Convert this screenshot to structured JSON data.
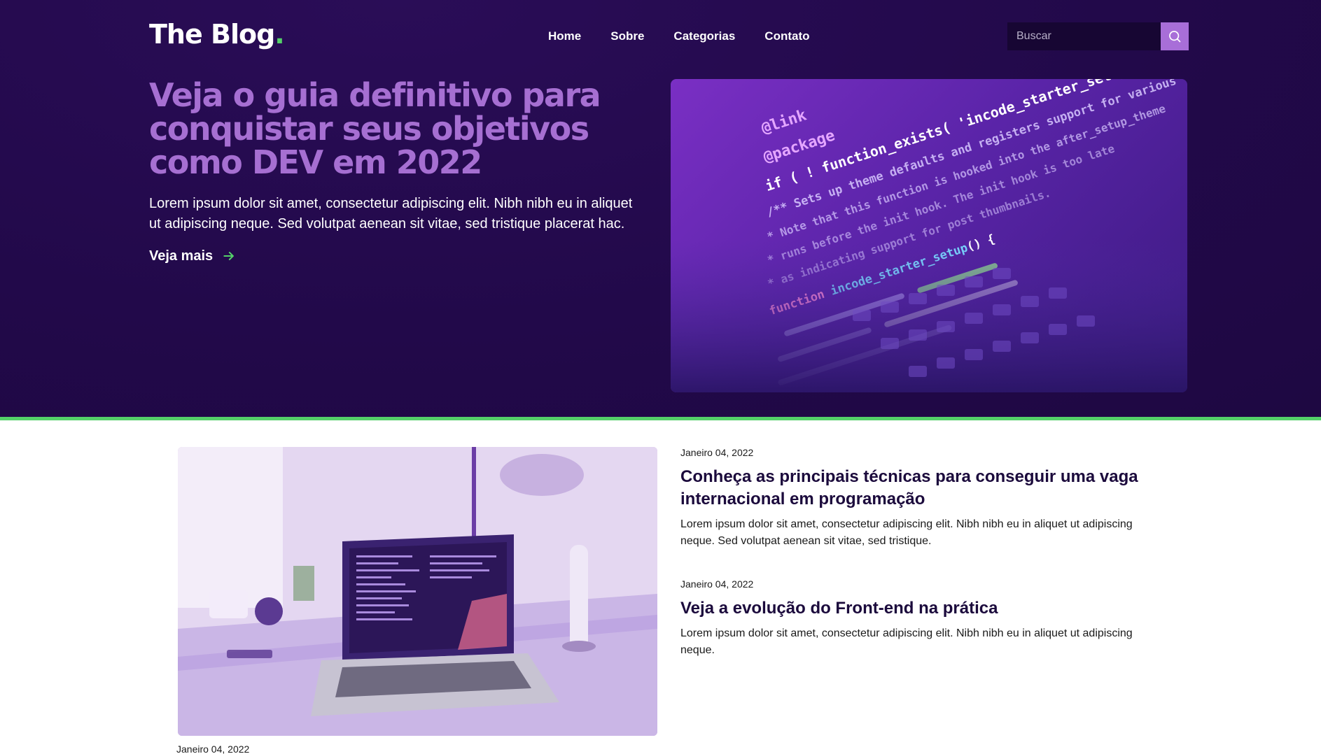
{
  "header": {
    "logo_text": "The Blog",
    "logo_dot": ".",
    "nav": [
      {
        "label": "Home"
      },
      {
        "label": "Sobre"
      },
      {
        "label": "Categorias"
      },
      {
        "label": "Contato"
      }
    ],
    "search": {
      "placeholder": "Buscar",
      "icon": "search-icon"
    }
  },
  "hero": {
    "title": "Veja o guia definitivo para conquistar seus objetivos como DEV em 2022",
    "description": "Lorem ipsum dolor sit amet, consectetur adipiscing elit. Nibh nibh eu in aliquet ut adipiscing neque. Sed volutpat aenean sit vitae, sed tristique placerat hac.",
    "cta_label": "Veja mais",
    "cta_icon": "arrow-right-icon"
  },
  "posts": [
    {
      "date": "Janeiro 04, 2022",
      "title": "Conheça as principais técnicas para conseguir uma vaga internacional em programação",
      "excerpt": "Lorem ipsum dolor sit amet, consectetur adipiscing elit. Nibh nibh eu in aliquet ut adipiscing neque. Sed volutpat aenean sit vitae, sed tristique."
    },
    {
      "date": "Janeiro 04, 2022",
      "title": "Veja a evolução do Front-end na prática",
      "excerpt": "Lorem ipsum dolor sit amet, consectetur adipiscing elit. Nibh nibh eu in aliquet ut adipiscing neque."
    }
  ],
  "bottom_post": {
    "date": "Janeiro 04, 2022"
  },
  "colors": {
    "hero_bg": "#22094a",
    "accent_purple": "#a66fd2",
    "accent_green": "#54d169",
    "search_button": "#a86ed8",
    "heading_dark": "#1b0a3c"
  }
}
